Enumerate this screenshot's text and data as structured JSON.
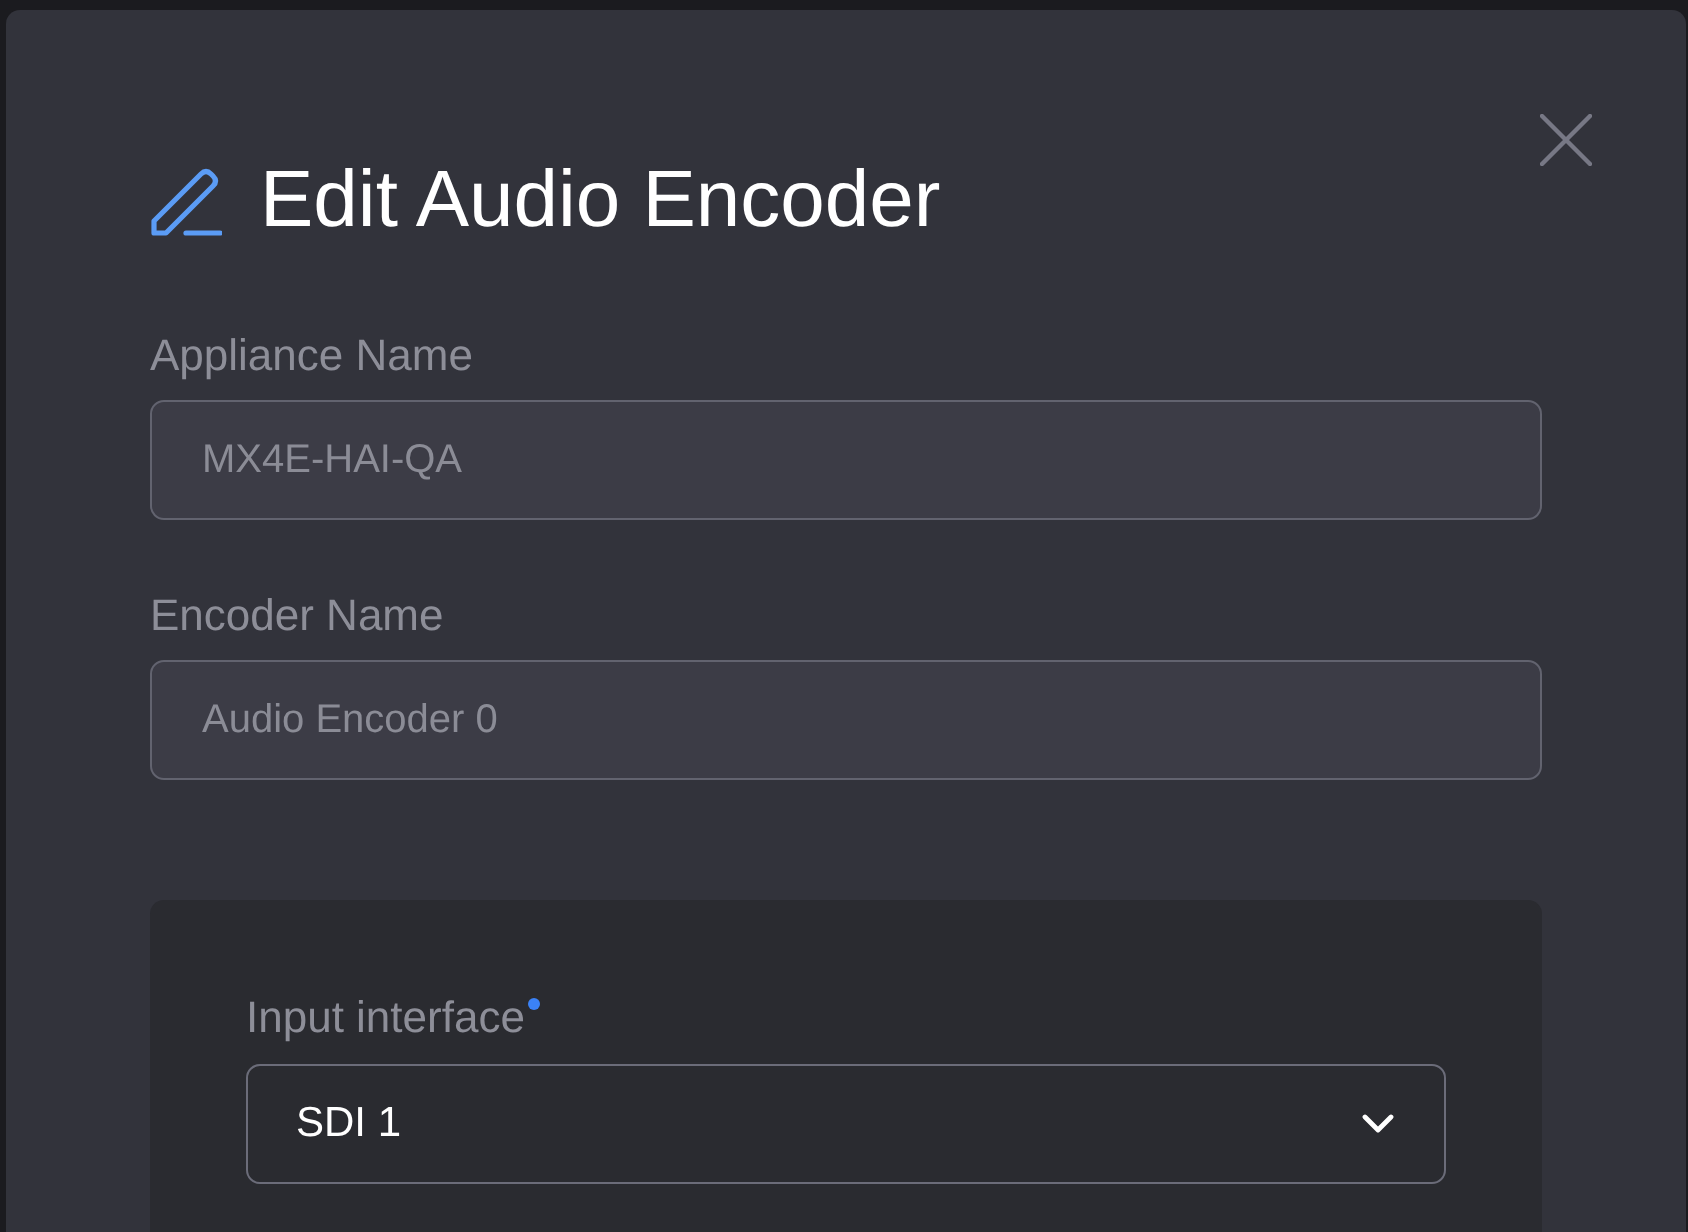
{
  "dialog": {
    "title": "Edit Audio Encoder"
  },
  "fields": [
    {
      "label": "Appliance Name",
      "value": "MX4E-HAI-QA",
      "disabled": true
    },
    {
      "label": "Encoder Name",
      "value": "Audio Encoder 0",
      "disabled": true
    }
  ],
  "panel": {
    "fields": [
      {
        "label": "Input interface",
        "required": true,
        "value": "SDI 1"
      }
    ]
  }
}
